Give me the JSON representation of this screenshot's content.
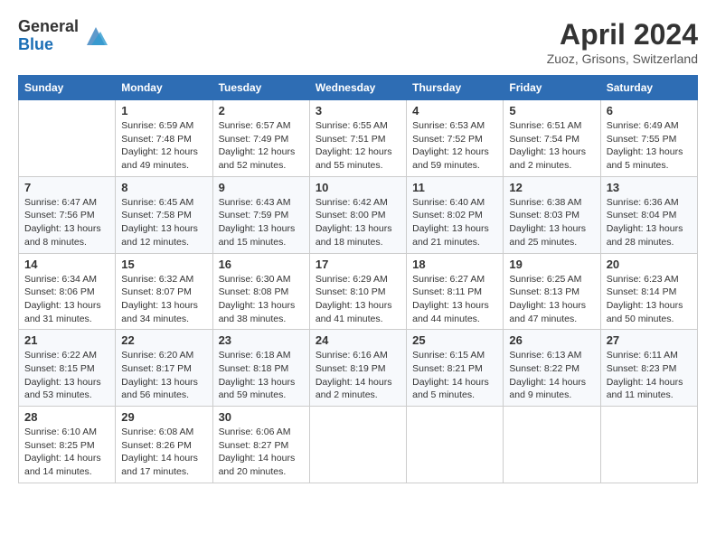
{
  "header": {
    "logo_general": "General",
    "logo_blue": "Blue",
    "title": "April 2024",
    "subtitle": "Zuoz, Grisons, Switzerland"
  },
  "columns": [
    "Sunday",
    "Monday",
    "Tuesday",
    "Wednesday",
    "Thursday",
    "Friday",
    "Saturday"
  ],
  "weeks": [
    [
      {
        "day": "",
        "sunrise": "",
        "sunset": "",
        "daylight": ""
      },
      {
        "day": "1",
        "sunrise": "Sunrise: 6:59 AM",
        "sunset": "Sunset: 7:48 PM",
        "daylight": "Daylight: 12 hours and 49 minutes."
      },
      {
        "day": "2",
        "sunrise": "Sunrise: 6:57 AM",
        "sunset": "Sunset: 7:49 PM",
        "daylight": "Daylight: 12 hours and 52 minutes."
      },
      {
        "day": "3",
        "sunrise": "Sunrise: 6:55 AM",
        "sunset": "Sunset: 7:51 PM",
        "daylight": "Daylight: 12 hours and 55 minutes."
      },
      {
        "day": "4",
        "sunrise": "Sunrise: 6:53 AM",
        "sunset": "Sunset: 7:52 PM",
        "daylight": "Daylight: 12 hours and 59 minutes."
      },
      {
        "day": "5",
        "sunrise": "Sunrise: 6:51 AM",
        "sunset": "Sunset: 7:54 PM",
        "daylight": "Daylight: 13 hours and 2 minutes."
      },
      {
        "day": "6",
        "sunrise": "Sunrise: 6:49 AM",
        "sunset": "Sunset: 7:55 PM",
        "daylight": "Daylight: 13 hours and 5 minutes."
      }
    ],
    [
      {
        "day": "7",
        "sunrise": "Sunrise: 6:47 AM",
        "sunset": "Sunset: 7:56 PM",
        "daylight": "Daylight: 13 hours and 8 minutes."
      },
      {
        "day": "8",
        "sunrise": "Sunrise: 6:45 AM",
        "sunset": "Sunset: 7:58 PM",
        "daylight": "Daylight: 13 hours and 12 minutes."
      },
      {
        "day": "9",
        "sunrise": "Sunrise: 6:43 AM",
        "sunset": "Sunset: 7:59 PM",
        "daylight": "Daylight: 13 hours and 15 minutes."
      },
      {
        "day": "10",
        "sunrise": "Sunrise: 6:42 AM",
        "sunset": "Sunset: 8:00 PM",
        "daylight": "Daylight: 13 hours and 18 minutes."
      },
      {
        "day": "11",
        "sunrise": "Sunrise: 6:40 AM",
        "sunset": "Sunset: 8:02 PM",
        "daylight": "Daylight: 13 hours and 21 minutes."
      },
      {
        "day": "12",
        "sunrise": "Sunrise: 6:38 AM",
        "sunset": "Sunset: 8:03 PM",
        "daylight": "Daylight: 13 hours and 25 minutes."
      },
      {
        "day": "13",
        "sunrise": "Sunrise: 6:36 AM",
        "sunset": "Sunset: 8:04 PM",
        "daylight": "Daylight: 13 hours and 28 minutes."
      }
    ],
    [
      {
        "day": "14",
        "sunrise": "Sunrise: 6:34 AM",
        "sunset": "Sunset: 8:06 PM",
        "daylight": "Daylight: 13 hours and 31 minutes."
      },
      {
        "day": "15",
        "sunrise": "Sunrise: 6:32 AM",
        "sunset": "Sunset: 8:07 PM",
        "daylight": "Daylight: 13 hours and 34 minutes."
      },
      {
        "day": "16",
        "sunrise": "Sunrise: 6:30 AM",
        "sunset": "Sunset: 8:08 PM",
        "daylight": "Daylight: 13 hours and 38 minutes."
      },
      {
        "day": "17",
        "sunrise": "Sunrise: 6:29 AM",
        "sunset": "Sunset: 8:10 PM",
        "daylight": "Daylight: 13 hours and 41 minutes."
      },
      {
        "day": "18",
        "sunrise": "Sunrise: 6:27 AM",
        "sunset": "Sunset: 8:11 PM",
        "daylight": "Daylight: 13 hours and 44 minutes."
      },
      {
        "day": "19",
        "sunrise": "Sunrise: 6:25 AM",
        "sunset": "Sunset: 8:13 PM",
        "daylight": "Daylight: 13 hours and 47 minutes."
      },
      {
        "day": "20",
        "sunrise": "Sunrise: 6:23 AM",
        "sunset": "Sunset: 8:14 PM",
        "daylight": "Daylight: 13 hours and 50 minutes."
      }
    ],
    [
      {
        "day": "21",
        "sunrise": "Sunrise: 6:22 AM",
        "sunset": "Sunset: 8:15 PM",
        "daylight": "Daylight: 13 hours and 53 minutes."
      },
      {
        "day": "22",
        "sunrise": "Sunrise: 6:20 AM",
        "sunset": "Sunset: 8:17 PM",
        "daylight": "Daylight: 13 hours and 56 minutes."
      },
      {
        "day": "23",
        "sunrise": "Sunrise: 6:18 AM",
        "sunset": "Sunset: 8:18 PM",
        "daylight": "Daylight: 13 hours and 59 minutes."
      },
      {
        "day": "24",
        "sunrise": "Sunrise: 6:16 AM",
        "sunset": "Sunset: 8:19 PM",
        "daylight": "Daylight: 14 hours and 2 minutes."
      },
      {
        "day": "25",
        "sunrise": "Sunrise: 6:15 AM",
        "sunset": "Sunset: 8:21 PM",
        "daylight": "Daylight: 14 hours and 5 minutes."
      },
      {
        "day": "26",
        "sunrise": "Sunrise: 6:13 AM",
        "sunset": "Sunset: 8:22 PM",
        "daylight": "Daylight: 14 hours and 9 minutes."
      },
      {
        "day": "27",
        "sunrise": "Sunrise: 6:11 AM",
        "sunset": "Sunset: 8:23 PM",
        "daylight": "Daylight: 14 hours and 11 minutes."
      }
    ],
    [
      {
        "day": "28",
        "sunrise": "Sunrise: 6:10 AM",
        "sunset": "Sunset: 8:25 PM",
        "daylight": "Daylight: 14 hours and 14 minutes."
      },
      {
        "day": "29",
        "sunrise": "Sunrise: 6:08 AM",
        "sunset": "Sunset: 8:26 PM",
        "daylight": "Daylight: 14 hours and 17 minutes."
      },
      {
        "day": "30",
        "sunrise": "Sunrise: 6:06 AM",
        "sunset": "Sunset: 8:27 PM",
        "daylight": "Daylight: 14 hours and 20 minutes."
      },
      {
        "day": "",
        "sunrise": "",
        "sunset": "",
        "daylight": ""
      },
      {
        "day": "",
        "sunrise": "",
        "sunset": "",
        "daylight": ""
      },
      {
        "day": "",
        "sunrise": "",
        "sunset": "",
        "daylight": ""
      },
      {
        "day": "",
        "sunrise": "",
        "sunset": "",
        "daylight": ""
      }
    ]
  ]
}
